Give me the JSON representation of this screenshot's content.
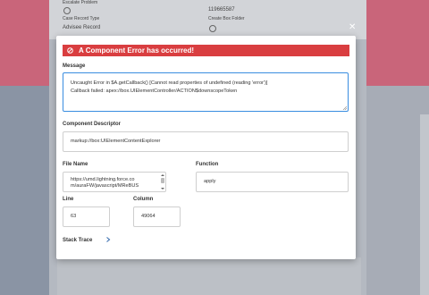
{
  "background": {
    "fields": [
      {
        "label": "Escalate Problem",
        "value": ""
      },
      {
        "label": "",
        "value": "119665587"
      },
      {
        "label": "Case Record Type",
        "value": "Advisee Record"
      },
      {
        "label": "Create Box Folder",
        "value": ""
      }
    ]
  },
  "modal": {
    "header_title": "A Component Error has occurred!",
    "message_label": "Message",
    "message_line1": "Uncaught Error in $A.getCallback() [Cannot read properties of undefined (reading 'error')]",
    "message_line2": "Callback failed: apex://box.UIElementController/ACTION$downscopeToken",
    "descriptor_label": "Component Descriptor",
    "descriptor_value": "markup://box:UIElementContentExplorer",
    "file_label": "File Name",
    "file_line1": "https://umd.lightning.force.co",
    "file_line2": "m/auraFW/javascript/MReBUS",
    "function_label": "Function",
    "function_value": "apply",
    "line_label": "Line",
    "line_value": "63",
    "column_label": "Column",
    "column_value": "49064",
    "stack_trace_label": "Stack Trace"
  },
  "colors": {
    "error_header": "#d93e40",
    "focus_border": "#3a8de0",
    "backdrop_pink": "#c9657a"
  }
}
